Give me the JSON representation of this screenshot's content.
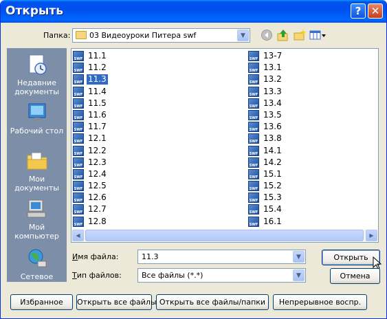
{
  "window": {
    "title": "Открыть"
  },
  "titlebar": {
    "help": "?",
    "close": "✕"
  },
  "lookin": {
    "label": "Папка:",
    "value": "03 Видеоуроки Питера swf"
  },
  "places": [
    {
      "label": "Недавние документы"
    },
    {
      "label": "Рабочий стол"
    },
    {
      "label": "Мои документы"
    },
    {
      "label": "Мой компьютер"
    },
    {
      "label": "Сетевое"
    }
  ],
  "files": {
    "col1": [
      "11.1",
      "11.2",
      "11.3",
      "11.4",
      "11.5",
      "11.6",
      "11.7",
      "12.1",
      "12.2",
      "12.3",
      "12.4",
      "12.5",
      "12.6",
      "12.7",
      "12.8"
    ],
    "col2": [
      "13-7",
      "13.1",
      "13.2",
      "13.3",
      "13.4",
      "13.5",
      "13.6",
      "13.8",
      "14.1",
      "14.2",
      "15.1",
      "15.2",
      "15.3",
      "15.4",
      "16.1"
    ],
    "selected": "11.3",
    "icon_text": "SWF"
  },
  "filename": {
    "label": "Имя файла:",
    "value": "11.3"
  },
  "filetype": {
    "label": "Тип файлов:",
    "value": "Все файлы (*.*)"
  },
  "buttons": {
    "open": "Открыть",
    "cancel": "Отмена",
    "favorites": "Избранное",
    "open_all_files": "Открыть все файлы",
    "open_all_files_folders": "Открыть все файлы/папки",
    "continuous_play": "Непрерывное воспр."
  },
  "colors": {
    "titlebar": "#0054e3",
    "selection": "#316ac5",
    "places_bar": "#7c8ea8"
  }
}
